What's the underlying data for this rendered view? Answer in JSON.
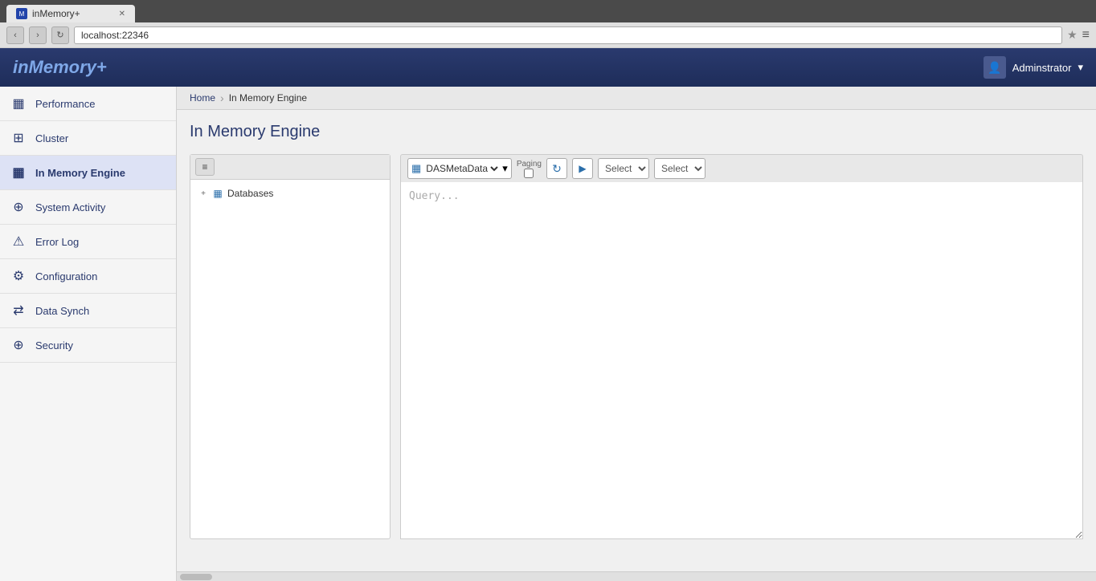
{
  "browser": {
    "tab_title": "inMemory+",
    "tab_favicon": "M",
    "address": "localhost:22346",
    "nav_back": "‹",
    "nav_forward": "›",
    "nav_reload": "↻",
    "bookmark": "★",
    "menu": "≡"
  },
  "app": {
    "logo": "inMemory+",
    "user": {
      "label": "Adminstrator",
      "dropdown": "▾",
      "icon": "👤"
    }
  },
  "breadcrumb": {
    "home": "Home",
    "separator": "›",
    "current": "In Memory Engine"
  },
  "page": {
    "title": "In Memory Engine"
  },
  "sidebar": {
    "items": [
      {
        "id": "performance",
        "label": "Performance",
        "icon": "▦"
      },
      {
        "id": "cluster",
        "label": "Cluster",
        "icon": "⊞"
      },
      {
        "id": "in-memory-engine",
        "label": "In Memory Engine",
        "icon": "▦"
      },
      {
        "id": "system-activity",
        "label": "System Activity",
        "icon": "⊕"
      },
      {
        "id": "error-log",
        "label": "Error Log",
        "icon": "⚠"
      },
      {
        "id": "configuration",
        "label": "Configuration",
        "icon": "⚙"
      },
      {
        "id": "data-synch",
        "label": "Data Synch",
        "icon": "⇄"
      },
      {
        "id": "security",
        "label": "Security",
        "icon": "⊕"
      }
    ]
  },
  "tree": {
    "toolbar_btn_label": "≡",
    "item_expand": "+",
    "item_icon": "▦",
    "item_label": "Databases"
  },
  "query": {
    "db_select_value": "DASMetaData",
    "db_select_icon": "▦",
    "paging_label": "Paging",
    "refresh_icon": "↻",
    "run_icon": "▶",
    "select1_value": "Select",
    "select1_options": [
      "Select"
    ],
    "select2_value": "Select",
    "select2_options": [
      "Select"
    ],
    "textarea_placeholder": "Query..."
  }
}
